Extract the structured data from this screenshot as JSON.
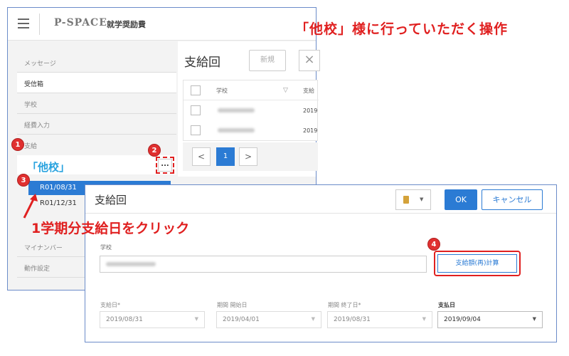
{
  "header": {
    "logo": "P-SPACE",
    "app_title": "就学奨励費"
  },
  "sidebar": {
    "items": [
      {
        "label": "メッセージ"
      },
      {
        "label": "受信箱"
      },
      {
        "label": "学校"
      },
      {
        "label": "経費入力"
      },
      {
        "label": "支給"
      },
      {
        "label": "マイナンバー"
      },
      {
        "label": "動作設定"
      }
    ],
    "sub_items": [
      {
        "label": "R01/08/31"
      },
      {
        "label": "R01/12/31"
      }
    ],
    "ellipsis_label": "..."
  },
  "main": {
    "title": "支給回",
    "new_button": "新規",
    "close_button": "×",
    "grid": {
      "header_school": "学校",
      "header_payment": "支給",
      "row_years": [
        "2019",
        "2019"
      ]
    },
    "pager": {
      "prev": "<",
      "current": "1",
      "next": ">"
    }
  },
  "dialog": {
    "title": "支給回",
    "ok_label": "OK",
    "cancel_label": "キャンセル",
    "school_label": "学校",
    "recalc_button": "支給額(再)計算",
    "fields": [
      {
        "label": "支給日*",
        "value": "2019/08/31"
      },
      {
        "label": "期間 開始日",
        "value": "2019/04/01"
      },
      {
        "label": "期間 終了日*",
        "value": "2019/08/31"
      },
      {
        "label": "支払日",
        "value": "2019/09/04"
      }
    ]
  },
  "annotations": {
    "top_note": "「他校」様に行っていただく操作",
    "other_school": "「他校」",
    "click_note": "1学期分支給日をクリック",
    "badges": [
      "1",
      "2",
      "3",
      "4"
    ]
  },
  "colors": {
    "accent": "#2b7bd4",
    "annotation_red": "#e02020",
    "annotation_blue": "#2aa3df"
  }
}
